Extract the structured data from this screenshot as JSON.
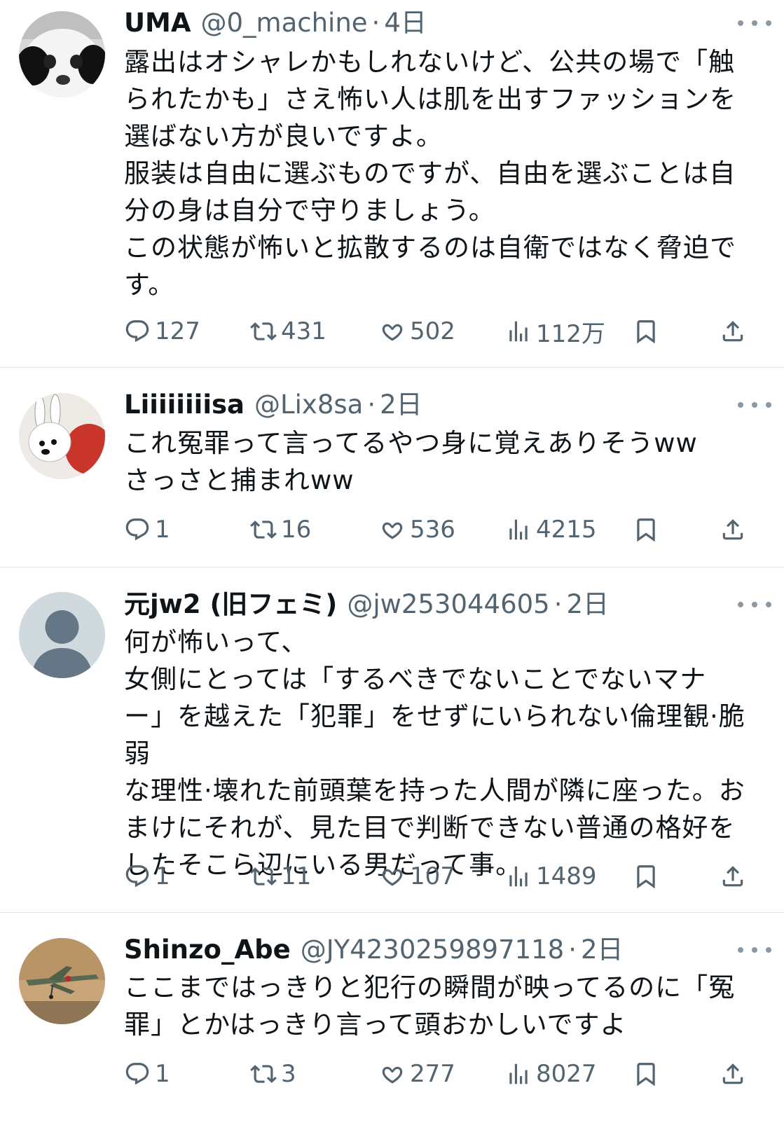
{
  "tweets": [
    {
      "name": "UMA",
      "handle": "@0_machine",
      "separator": "·",
      "time": "4日",
      "body": "露出はオシャレかもしれないけど、公共の場で「触\nられたかも」さえ怖い人は肌を出すファッションを\n選ばない方が良いですよ。\n服装は自由に選ぶものですが、自由を選ぶことは自\n分の身は自分で守りましょう。\nこの状態が怖いと拡散するのは自衛ではなく脅迫で\nす。",
      "replies": "127",
      "retweets": "431",
      "likes": "502",
      "views": "112万",
      "avatar": "panda-plush"
    },
    {
      "name": "Liiiiiiiisa",
      "handle": "@Lix8sa",
      "separator": "·",
      "time": "2日",
      "body": "これ冤罪って言ってるやつ身に覚えありそうww\nさっさと捕まれww",
      "replies": "1",
      "retweets": "16",
      "likes": "536",
      "views": "4215",
      "avatar": "white-rabbit"
    },
    {
      "name": "元jw2 (旧フェミ)",
      "handle": "@jw253044605",
      "separator": "·",
      "time": "2日",
      "body": "何が怖いって、\n女側にとっては「するべきでないことでないマナ\nー」を越えた「犯罪」をせずにいられない倫理観·脆弱\nな理性·壊れた前頭葉を持った人間が隣に座った。お\nまけにそれが、見た目で判断できない普通の格好を\nしたそこら辺にいる男だって事。",
      "replies": "1",
      "retweets": "11",
      "likes": "107",
      "views": "1489",
      "avatar": "default-person"
    },
    {
      "name": "Shinzo_Abe",
      "handle": "@JY4230259897118",
      "separator": "·",
      "time": "2日",
      "body": "ここまではっきりと犯行の瞬間が映ってるのに「冤\n罪」とかはっきり言って頭おかしいですよ",
      "replies": "1",
      "retweets": "3",
      "likes": "277",
      "views": "8027",
      "avatar": "vintage-airplane"
    }
  ],
  "icons": {
    "reply": "reply-icon",
    "retweet": "retweet-icon",
    "like": "heart-icon",
    "views": "views-icon",
    "bookmark": "bookmark-icon",
    "share": "share-icon",
    "more": "more-icon"
  },
  "colors": {
    "text": "#0f1419",
    "secondary": "#536471",
    "divider": "#e5e7ea"
  }
}
